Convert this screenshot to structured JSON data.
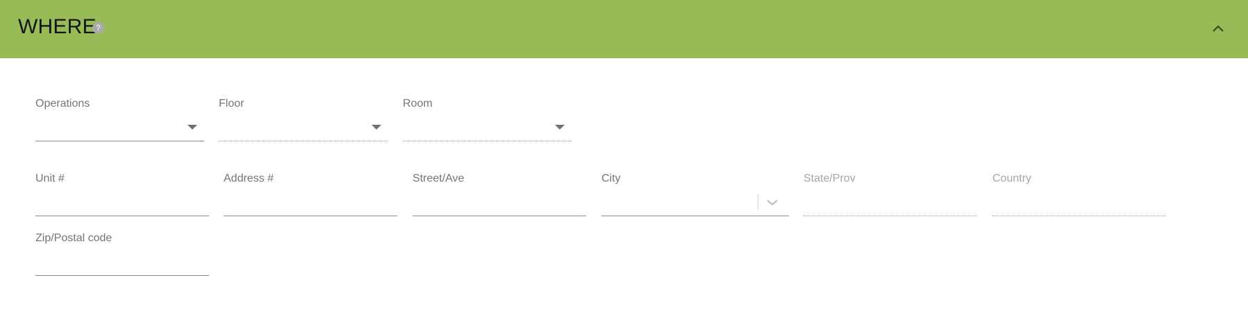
{
  "section": {
    "title": "WHERE",
    "help_symbol": "?",
    "help_icon": "help-circle-icon",
    "collapse_icon": "chevron-up-icon"
  },
  "colors": {
    "header_bg": "#98bb57",
    "title": "#141414",
    "label": "#757575",
    "disabled_label": "#a5a5a5",
    "underline": "#8a8a8a"
  },
  "fields": {
    "operations": {
      "label": "Operations",
      "value": ""
    },
    "floor": {
      "label": "Floor",
      "value": ""
    },
    "room": {
      "label": "Room",
      "value": ""
    },
    "unit": {
      "label": "Unit #",
      "value": ""
    },
    "address": {
      "label": "Address #",
      "value": ""
    },
    "street": {
      "label": "Street/Ave",
      "value": ""
    },
    "city": {
      "label": "City",
      "value": ""
    },
    "state": {
      "label": "State/Prov",
      "value": ""
    },
    "country": {
      "label": "Country",
      "value": ""
    },
    "zip": {
      "label": "Zip/Postal code",
      "value": ""
    }
  }
}
